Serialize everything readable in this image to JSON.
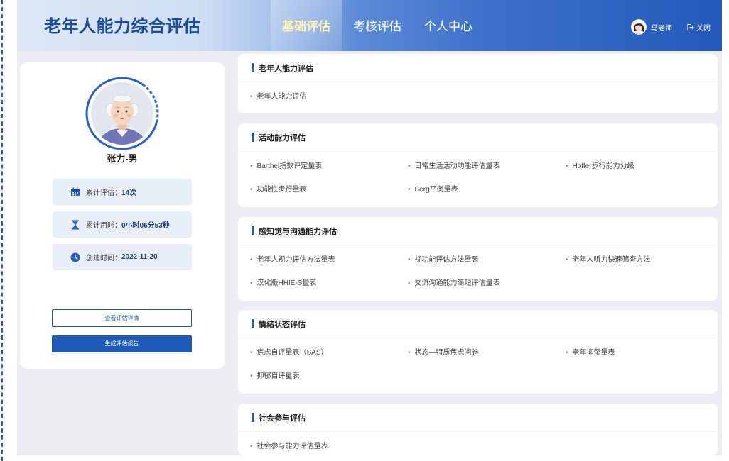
{
  "app": {
    "title": "老年人能力综合评估"
  },
  "nav": {
    "tabs": [
      {
        "label": "基础评估",
        "active": true
      },
      {
        "label": "考核评估",
        "active": false
      },
      {
        "label": "个人中心",
        "active": false
      }
    ]
  },
  "user": {
    "name": "马老师",
    "logout_label": "关闭",
    "avatar_icon": "user-avatar-icon",
    "logout_icon": "logout-icon"
  },
  "profile": {
    "name": "张力-男",
    "avatar_icon": "elderly-person-avatar",
    "stats": [
      {
        "icon": "calendar-icon",
        "label": "累计评估：",
        "value": "14次"
      },
      {
        "icon": "hourglass-icon",
        "label": "累计用时：",
        "value": "0小时06分53秒"
      },
      {
        "icon": "clock-icon",
        "label": "创建时间：",
        "value": "2022-11-20"
      }
    ],
    "actions": {
      "view_details": "查看评估详情",
      "generate_report": "生成评估报告"
    }
  },
  "sections": [
    {
      "title": "老年人能力评估",
      "items": [
        "老年人能力评估"
      ]
    },
    {
      "title": "活动能力评估",
      "items": [
        "Barthel指数评定量表",
        "日常生活活动功能评估量表",
        "Hoffer步行能力分级",
        "功能性步行量表",
        "Berg平衡量表"
      ]
    },
    {
      "title": "感知觉与沟通能力评估",
      "items": [
        "老年人视力评估方法量表",
        "视功能评估方法量表",
        "老年人听力快速筛查方法",
        "汉化版HHIE-S量表",
        "交流沟通能力简短评估量表"
      ]
    },
    {
      "title": "情绪状态评估",
      "items": [
        "焦虑自评量表（SAS）",
        "状态—特质焦虑问卷",
        "老年抑郁量表",
        "抑郁自评量表"
      ]
    },
    {
      "title": "社会参与评估",
      "items": [
        "社会参与能力评估量表"
      ]
    }
  ],
  "colors": {
    "accent": "#1f5bb8",
    "title": "#1d4e9e",
    "active_tab_text": "#fff3b0",
    "stat_bg": "#e8eff9"
  }
}
